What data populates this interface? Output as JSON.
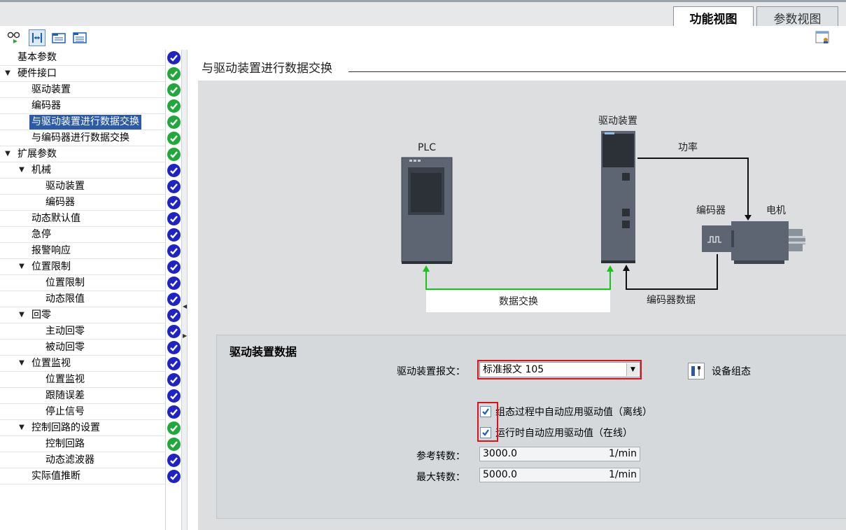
{
  "tabs": [
    {
      "label": "功能视图",
      "active": true
    },
    {
      "label": "参数视图",
      "active": false
    }
  ],
  "toolbar": {
    "icons": [
      "glasses-icon",
      "expand-horizontal-icon",
      "folder-icon",
      "list-icon"
    ]
  },
  "tree": {
    "items": [
      {
        "label": "基本参数",
        "level": 0,
        "arrow": "",
        "status": "blue",
        "selected": false
      },
      {
        "label": "硬件接口",
        "level": 0,
        "arrow": "▼",
        "status": "green",
        "selected": false
      },
      {
        "label": "驱动装置",
        "level": 1,
        "arrow": "",
        "status": "green",
        "selected": false
      },
      {
        "label": "编码器",
        "level": 1,
        "arrow": "",
        "status": "green",
        "selected": false
      },
      {
        "label": "与驱动装置进行数据交换",
        "level": 1,
        "arrow": "",
        "status": "green",
        "selected": true
      },
      {
        "label": "与编码器进行数据交换",
        "level": 1,
        "arrow": "",
        "status": "green",
        "selected": false
      },
      {
        "label": "扩展参数",
        "level": 0,
        "arrow": "▼",
        "status": "green",
        "selected": false
      },
      {
        "label": "机械",
        "level": 1,
        "arrow": "▼",
        "status": "blue",
        "selected": false
      },
      {
        "label": "驱动装置",
        "level": 2,
        "arrow": "",
        "status": "blue",
        "selected": false
      },
      {
        "label": "编码器",
        "level": 2,
        "arrow": "",
        "status": "blue",
        "selected": false
      },
      {
        "label": "动态默认值",
        "level": 1,
        "arrow": "",
        "status": "blue",
        "selected": false
      },
      {
        "label": "急停",
        "level": 1,
        "arrow": "",
        "status": "blue",
        "selected": false
      },
      {
        "label": "报警响应",
        "level": 1,
        "arrow": "",
        "status": "blue",
        "selected": false
      },
      {
        "label": "位置限制",
        "level": 1,
        "arrow": "▼",
        "status": "blue",
        "selected": false
      },
      {
        "label": "位置限制",
        "level": 2,
        "arrow": "",
        "status": "blue",
        "selected": false
      },
      {
        "label": "动态限值",
        "level": 2,
        "arrow": "",
        "status": "blue",
        "selected": false
      },
      {
        "label": "回零",
        "level": 1,
        "arrow": "▼",
        "status": "blue",
        "selected": false
      },
      {
        "label": "主动回零",
        "level": 2,
        "arrow": "",
        "status": "blue",
        "selected": false
      },
      {
        "label": "被动回零",
        "level": 2,
        "arrow": "",
        "status": "blue",
        "selected": false
      },
      {
        "label": "位置监视",
        "level": 1,
        "arrow": "▼",
        "status": "blue",
        "selected": false
      },
      {
        "label": "位置监视",
        "level": 2,
        "arrow": "",
        "status": "blue",
        "selected": false
      },
      {
        "label": "跟随误差",
        "level": 2,
        "arrow": "",
        "status": "blue",
        "selected": false
      },
      {
        "label": "停止信号",
        "level": 2,
        "arrow": "",
        "status": "blue",
        "selected": false
      },
      {
        "label": "控制回路的设置",
        "level": 1,
        "arrow": "▼",
        "status": "green",
        "selected": false
      },
      {
        "label": "控制回路",
        "level": 2,
        "arrow": "",
        "status": "green",
        "selected": false
      },
      {
        "label": "动态滤波器",
        "level": 2,
        "arrow": "",
        "status": "blue",
        "selected": false
      },
      {
        "label": "实际值推断",
        "level": 1,
        "arrow": "",
        "status": "blue",
        "selected": false
      }
    ]
  },
  "content": {
    "title": "与驱动装置进行数据交换"
  },
  "diagram": {
    "plc_label": "PLC",
    "drive_label": "驱动装置",
    "power_label": "功率",
    "encoder_label": "编码器",
    "motor_label": "电机",
    "data_exchange_label": "数据交换",
    "encoder_data_label": "编码器数据"
  },
  "drive_data": {
    "title": "驱动装置数据",
    "telegram_label": "驱动装置报文：",
    "telegram_value": "标准报文 105",
    "device_config_label": "设备组态",
    "auto_offline_label": "组态过程中自动应用驱动值（离线）",
    "auto_offline_checked": true,
    "auto_online_label": "运行时自动应用驱动值（在线）",
    "auto_online_checked": true,
    "ref_speed_label": "参考转数：",
    "ref_speed_value": "3000.0",
    "ref_speed_unit": "1/min",
    "max_speed_label": "最大转数：",
    "max_speed_value": "5000.0",
    "max_speed_unit": "1/min"
  },
  "colors": {
    "status_blue": "#1e23c8",
    "status_green": "#21a83b",
    "selection": "#2a5aa8",
    "highlight_red": "#e0101a",
    "data_line_green": "#19c419"
  }
}
